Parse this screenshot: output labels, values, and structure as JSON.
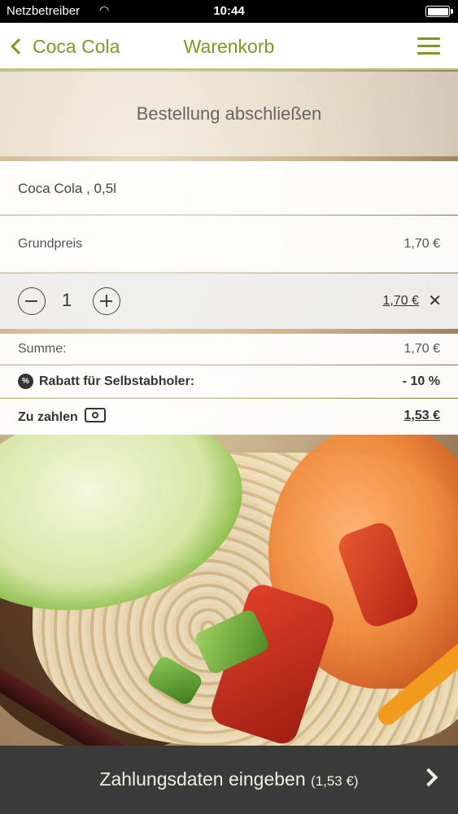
{
  "status_bar": {
    "carrier": "Netzbetreiber",
    "time": "10:44",
    "wifi_icon": "wifi-icon",
    "battery_icon": "battery-icon"
  },
  "nav": {
    "back_label": "Coca Cola",
    "title": "Warenkorb",
    "menu_icon": "hamburger-menu-icon"
  },
  "header": {
    "title": "Bestellung abschließen"
  },
  "cart": {
    "item": {
      "name": "Coca Cola , 0,5l",
      "base_price_label": "Grundpreis",
      "base_price": "1,70 €",
      "quantity": "1",
      "line_total": "1,70 €",
      "remove_icon": "close-icon"
    },
    "summary": {
      "sum_label": "Summe:",
      "sum_value": "1,70 €",
      "discount_label": "Rabatt für Selbstabholer:",
      "discount_value": "- 10 %",
      "discount_icon_text": "%",
      "total_label": "Zu zahlen",
      "total_value": "1,53 €",
      "cash_icon": "cash-icon"
    }
  },
  "checkout": {
    "label": "Zahlungsdaten eingeben",
    "amount": "(1,53 €)",
    "arrow_icon": "chevron-right-icon"
  }
}
